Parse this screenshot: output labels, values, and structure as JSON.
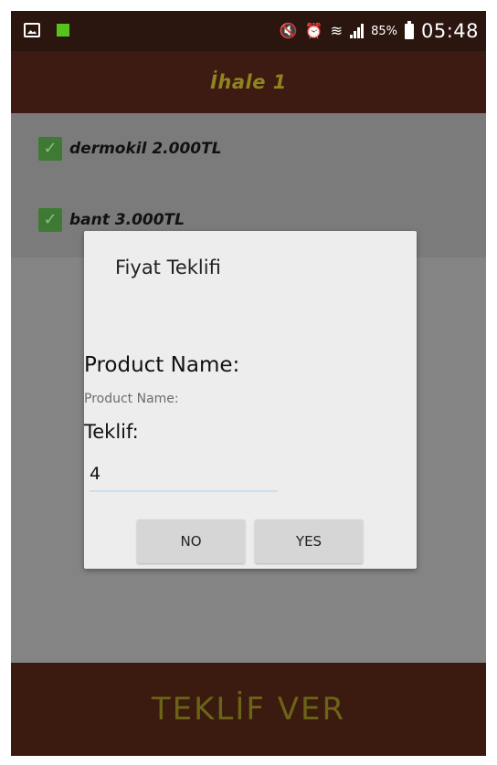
{
  "status_bar": {
    "battery_pct": "85%",
    "time": "05:48",
    "icons": [
      "image-icon",
      "app-notification-icon",
      "mute-icon",
      "alarm-icon",
      "wifi-icon",
      "signal-icon",
      "battery-icon"
    ]
  },
  "action_bar": {
    "title": "İhale 1"
  },
  "list": {
    "items": [
      {
        "label": "dermokil  2.000TL",
        "checked": true
      },
      {
        "label": "bant  3.000TL",
        "checked": true
      }
    ]
  },
  "dialog": {
    "title": "Fiyat Teklifi",
    "product_name_label": "Product Name:",
    "product_name_value": "Product Name:",
    "teklif_label": "Teklif:",
    "teklif_value": "4",
    "no_label": "NO",
    "yes_label": "YES"
  },
  "bottom_bar": {
    "label": "TEKLİF VER"
  },
  "colors": {
    "status_bar_bg": "#2b150f",
    "action_bar_bg": "#3d1a12",
    "title_color": "#8f8420",
    "checkbox": "#3e7a34",
    "bottom_bar_bg": "#3b1a0f",
    "bottom_text": "#6b6418",
    "dialog_bg": "#ededed",
    "input_underline": "#c7dff2"
  }
}
